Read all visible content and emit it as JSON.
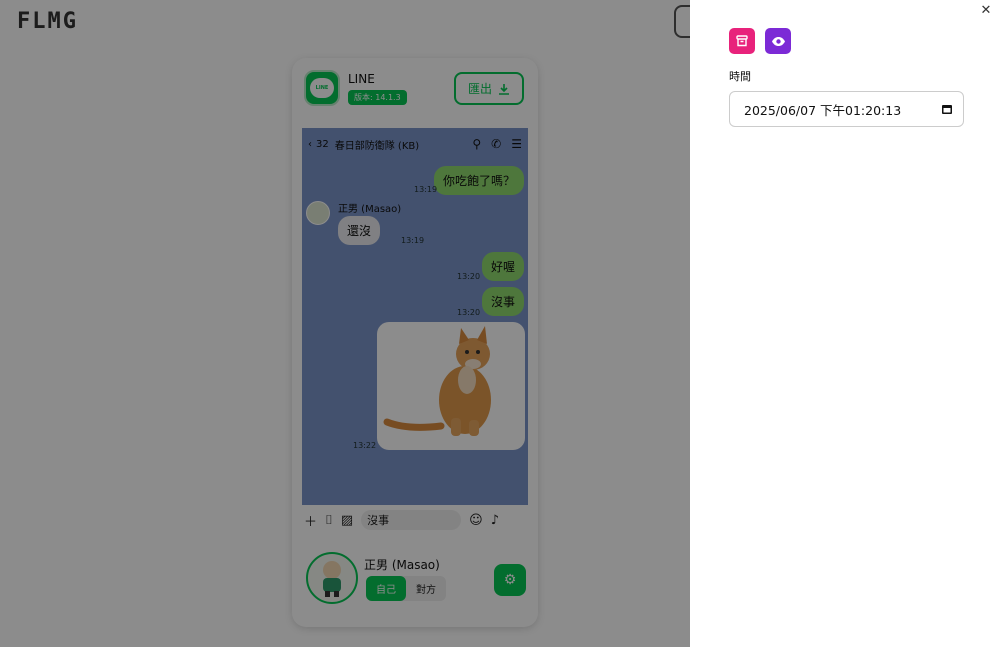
{
  "app": {
    "logo": "FLMG"
  },
  "phone": {
    "app_name": "LINE",
    "app_version": "版本: 14.1.3",
    "export_label": "匯出",
    "chat": {
      "back_count": "32",
      "title": "春日部防衛隊 (KB)",
      "sender_name": "正男 (Masao)",
      "messages": [
        {
          "side": "right",
          "text": "你吃飽了嗎？",
          "time": "13:19"
        },
        {
          "side": "left",
          "text": "還沒",
          "time": "13:19"
        },
        {
          "side": "right",
          "text": "好喔",
          "time": "13:20"
        },
        {
          "side": "right",
          "text": "沒事",
          "time": "13:20"
        },
        {
          "side": "right",
          "type": "image",
          "time": "13:22"
        }
      ]
    },
    "input_value": "沒事",
    "user": {
      "name": "正男 (Masao)",
      "self_label": "自己",
      "other_label": "對方",
      "selected": "自己"
    }
  },
  "drawer": {
    "time_label": "時間",
    "datetime_value": "2025/06/07 下午01:20:13"
  },
  "colors": {
    "line_green": "#06c755",
    "chat_bg": "#7b94c9",
    "delete": "#e8227b",
    "view": "#7c2ad6"
  }
}
